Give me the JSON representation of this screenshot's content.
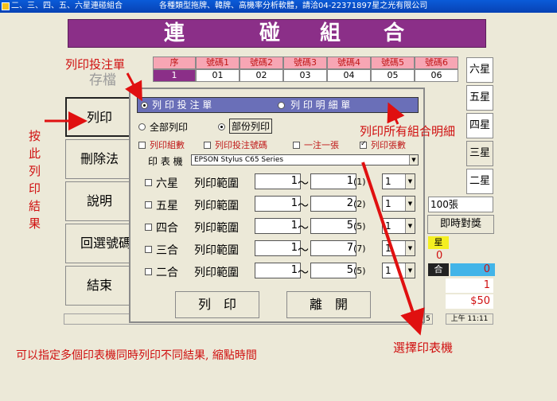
{
  "titlebar": {
    "app_title": "二、三、四、五、六星連碰組合",
    "company": "各種類型拖牌、韓牌、高機率分析軟體，請洽04-22371897星之光有限公司"
  },
  "banner": {
    "chars": [
      "連",
      "碰",
      "組",
      "合"
    ]
  },
  "number_table": {
    "headers": [
      "序",
      "號碼1",
      "號碼2",
      "號碼3",
      "號碼4",
      "號碼5",
      "號碼6"
    ],
    "row": [
      "1",
      "01",
      "02",
      "03",
      "04",
      "05",
      "06"
    ]
  },
  "star_tabs": [
    "六星",
    "五星",
    "四星",
    "三星",
    "二星"
  ],
  "left_buttons": {
    "ghost_save": "存檔",
    "print": "列印",
    "delete_method": "刪除法",
    "help": "說明",
    "return_numbers": "回選號碼",
    "exit": "結束"
  },
  "right_panel": {
    "count_100": "100張",
    "instant_check": "即時對獎",
    "star_label": "星",
    "zero_a": "0",
    "he_label": "合",
    "zero_b": "0",
    "one": "1",
    "fifty": "$50"
  },
  "statusbar": {
    "time": "上午 11:11",
    "page": "5"
  },
  "dialog": {
    "mode_print_ticket": "列 印 投 注 單",
    "mode_print_detail": "列 印 明 細 單",
    "print_all": "全部列印",
    "print_partial": "部份列印",
    "opt_group_count": "列印組數",
    "opt_bet_numbers": "列印投注號碼",
    "opt_one_per_sheet": "一注一張",
    "opt_sheet_count": "列印張數",
    "printer_label": "印 表 機",
    "printer_value": "EPSON Stylus C65 Series",
    "range_label": "列印範圍",
    "tilde": "～",
    "rows": [
      {
        "name": "六星",
        "from": "1",
        "to": "1",
        "total": "(1)",
        "count": "1"
      },
      {
        "name": "五星",
        "from": "1",
        "to": "2",
        "total": "(2)",
        "count": "1"
      },
      {
        "name": "四合",
        "from": "1",
        "to": "5",
        "total": "(5)",
        "count": "1"
      },
      {
        "name": "三合",
        "from": "1",
        "to": "7",
        "total": "(7)",
        "count": "1"
      },
      {
        "name": "二合",
        "from": "1",
        "to": "5",
        "total": "(5)",
        "count": "1"
      }
    ],
    "btn_print": "列　印",
    "btn_leave": "離　開"
  },
  "annotations": {
    "print_ticket": "列印投注單",
    "press_here": [
      "按",
      "此",
      "列",
      "印",
      "結",
      "果"
    ],
    "print_all_details": "列印所有組合明細",
    "choose_printer": "選擇印表機",
    "multi_printer_note": "可以指定多個印表機同時列印不同結果, 縮點時間"
  },
  "colors": {
    "banner": "#8b2f88",
    "annotation_red": "#d01010",
    "mode_bar": "#6a6fb8"
  }
}
